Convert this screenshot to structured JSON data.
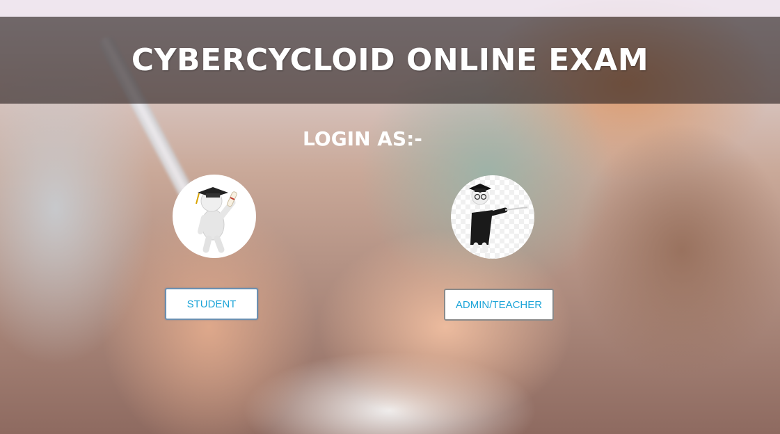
{
  "header": {
    "title": "CYBERCYCLOID ONLINE EXAM"
  },
  "login": {
    "heading": "LOGIN AS:-"
  },
  "roles": [
    {
      "label": "STUDENT",
      "icon": "graduate-student-icon"
    },
    {
      "label": "ADMIN/TEACHER",
      "icon": "teacher-pointer-icon"
    }
  ],
  "colors": {
    "button_text": "#1ea5d8",
    "header_overlay": "#281e1e",
    "title_text": "#ffffff"
  }
}
